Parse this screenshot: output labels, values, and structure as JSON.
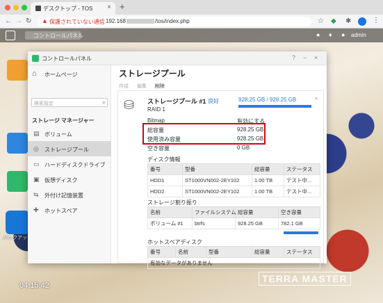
{
  "browser": {
    "tab_title": "デスクトップ - TOS",
    "new_tab": "+",
    "tab_close": "×",
    "warning": "保護されていない通信",
    "url_prefix": "192.168",
    "url_suffix": "/tos/index.php"
  },
  "taskbar": {
    "active_tab_label": "コントロールパネル",
    "user": "admin"
  },
  "desktop": {
    "icon_label": "バックアップ",
    "clock": "04:15:42",
    "brand": "TERRA MASTER"
  },
  "window": {
    "title": "コントロールパネル"
  },
  "sidebar": {
    "home": "ホームページ",
    "search_placeholder": "検索設定",
    "section_title": "ストレージ マネージャー",
    "items": [
      {
        "label": "ボリューム",
        "icon": "volume-icon"
      },
      {
        "label": "ストレージプール",
        "icon": "storage-pool-icon",
        "active": true
      },
      {
        "label": "ハードディスクドライブ",
        "icon": "hdd-icon"
      },
      {
        "label": "仮想ディスク",
        "icon": "virtual-disk-icon"
      },
      {
        "label": "外付け記憶装置",
        "icon": "external-storage-icon"
      },
      {
        "label": "ホットスペア",
        "icon": "hot-spare-icon"
      }
    ]
  },
  "main": {
    "title": "ストレージプール",
    "toolbar": {
      "create": "作成",
      "edit": "編集",
      "delete": "削除"
    },
    "pool": {
      "name": "ストレージプール #1",
      "status": "良好",
      "raid": "RAID 1",
      "capacity_text": "928.25 GB / 928.25 GB",
      "capacity_fraction": 1.0,
      "bitmap_label": "Bitmap",
      "bitmap_value": "有効にする",
      "total_label": "総容量",
      "total_value": "928.25 GB",
      "used_label": "使用済み容量",
      "used_value": "928.25 GB",
      "free_label": "空き容量",
      "free_value": "0 GB"
    },
    "disk_info": {
      "title": "ディスク情報",
      "headers": [
        "番号",
        "型番",
        "総容量",
        "ステータス"
      ],
      "rows": [
        [
          "HDD1",
          "ST1000VN002-2EY102",
          "1.00 TB",
          "テスト中..."
        ],
        [
          "HDD2",
          "ST1000VN002-2EY102",
          "1.00 TB",
          "テスト中..."
        ]
      ]
    },
    "allocation": {
      "title": "ストレージ割り振り",
      "headers": [
        "名前",
        "ファイルシステム",
        "総容量",
        "空き容量"
      ],
      "rows": [
        {
          "name": "ボリューム #1",
          "fs": "btrfs",
          "total": "928.25 GB",
          "free": "782.1 GB",
          "used_fraction": 1.0
        }
      ]
    },
    "hot_spare": {
      "title": "ホットスペアディスク",
      "headers": [
        "番号",
        "名前",
        "型番",
        "総容量",
        "ステータス"
      ],
      "empty": "有効なデータがありません"
    }
  }
}
